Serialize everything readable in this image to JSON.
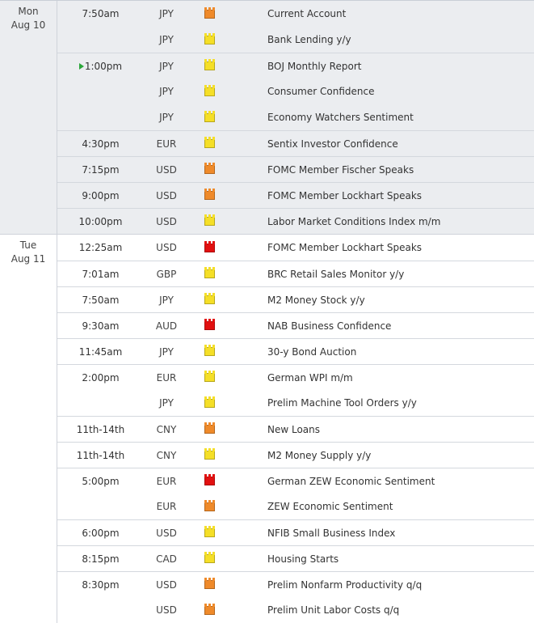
{
  "days": [
    {
      "weekday": "Mon",
      "date": "Aug 10",
      "events": [
        {
          "time": "7:50am",
          "currency": "JPY",
          "impact": "orange",
          "impact_icon": "folder-flag-orange-icon",
          "name": "Current Account",
          "border": false
        },
        {
          "time": "",
          "currency": "JPY",
          "impact": "yellow",
          "impact_icon": "folder-flag-yellow-icon",
          "name": "Bank Lending y/y",
          "border": false
        },
        {
          "time": "1:00pm",
          "currency": "JPY",
          "impact": "yellow",
          "impact_icon": "folder-flag-yellow-icon",
          "name": "BOJ Monthly Report",
          "border": true,
          "playing": true
        },
        {
          "time": "",
          "currency": "JPY",
          "impact": "yellow",
          "impact_icon": "folder-flag-yellow-icon",
          "name": "Consumer Confidence",
          "border": false
        },
        {
          "time": "",
          "currency": "JPY",
          "impact": "yellow",
          "impact_icon": "folder-flag-yellow-icon",
          "name": "Economy Watchers Sentiment",
          "border": false
        },
        {
          "time": "4:30pm",
          "currency": "EUR",
          "impact": "yellow",
          "impact_icon": "folder-flag-yellow-icon",
          "name": "Sentix Investor Confidence",
          "border": true
        },
        {
          "time": "7:15pm",
          "currency": "USD",
          "impact": "orange",
          "impact_icon": "folder-flag-orange-icon",
          "name": "FOMC Member Fischer Speaks",
          "border": true
        },
        {
          "time": "9:00pm",
          "currency": "USD",
          "impact": "orange",
          "impact_icon": "folder-flag-orange-icon",
          "name": "FOMC Member Lockhart Speaks",
          "border": true
        },
        {
          "time": "10:00pm",
          "currency": "USD",
          "impact": "yellow",
          "impact_icon": "folder-flag-yellow-icon",
          "name": "Labor Market Conditions Index m/m",
          "border": true
        }
      ]
    },
    {
      "weekday": "Tue",
      "date": "Aug 11",
      "events": [
        {
          "time": "12:25am",
          "currency": "USD",
          "impact": "red",
          "impact_icon": "folder-flag-red-icon",
          "name": "FOMC Member Lockhart Speaks",
          "border": false
        },
        {
          "time": "7:01am",
          "currency": "GBP",
          "impact": "yellow",
          "impact_icon": "folder-flag-yellow-icon",
          "name": "BRC Retail Sales Monitor y/y",
          "border": true
        },
        {
          "time": "7:50am",
          "currency": "JPY",
          "impact": "yellow",
          "impact_icon": "folder-flag-yellow-icon",
          "name": "M2 Money Stock y/y",
          "border": true
        },
        {
          "time": "9:30am",
          "currency": "AUD",
          "impact": "red",
          "impact_icon": "folder-flag-red-icon",
          "name": "NAB Business Confidence",
          "border": true
        },
        {
          "time": "11:45am",
          "currency": "JPY",
          "impact": "yellow",
          "impact_icon": "folder-flag-yellow-icon",
          "name": "30-y Bond Auction",
          "border": true
        },
        {
          "time": "2:00pm",
          "currency": "EUR",
          "impact": "yellow",
          "impact_icon": "folder-flag-yellow-icon",
          "name": "German WPI m/m",
          "border": true
        },
        {
          "time": "",
          "currency": "JPY",
          "impact": "yellow",
          "impact_icon": "folder-flag-yellow-icon",
          "name": "Prelim Machine Tool Orders y/y",
          "border": false
        },
        {
          "time": "11th-14th",
          "currency": "CNY",
          "impact": "orange",
          "impact_icon": "folder-flag-orange-icon",
          "name": "New Loans",
          "border": true
        },
        {
          "time": "11th-14th",
          "currency": "CNY",
          "impact": "yellow",
          "impact_icon": "folder-flag-yellow-icon",
          "name": "M2 Money Supply y/y",
          "border": true
        },
        {
          "time": "5:00pm",
          "currency": "EUR",
          "impact": "red",
          "impact_icon": "folder-flag-red-icon",
          "name": "German ZEW Economic Sentiment",
          "border": true
        },
        {
          "time": "",
          "currency": "EUR",
          "impact": "orange",
          "impact_icon": "folder-flag-orange-icon",
          "name": "ZEW Economic Sentiment",
          "border": false
        },
        {
          "time": "6:00pm",
          "currency": "USD",
          "impact": "yellow",
          "impact_icon": "folder-flag-yellow-icon",
          "name": "NFIB Small Business Index",
          "border": true
        },
        {
          "time": "8:15pm",
          "currency": "CAD",
          "impact": "yellow",
          "impact_icon": "folder-flag-yellow-icon",
          "name": "Housing Starts",
          "border": true
        },
        {
          "time": "8:30pm",
          "currency": "USD",
          "impact": "orange",
          "impact_icon": "folder-flag-orange-icon",
          "name": "Prelim Nonfarm Productivity q/q",
          "border": true
        },
        {
          "time": "",
          "currency": "USD",
          "impact": "orange",
          "impact_icon": "folder-flag-orange-icon",
          "name": "Prelim Unit Labor Costs q/q",
          "border": false
        }
      ]
    }
  ]
}
